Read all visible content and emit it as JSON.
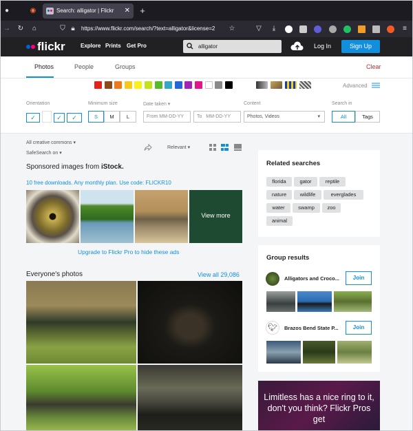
{
  "browser": {
    "tab_title": "Search: alligator | Flickr",
    "url": "https://www.flickr.com/search/?text=alligator&license=2"
  },
  "header": {
    "logo": "flickr",
    "nav": [
      "Explore",
      "Prints",
      "Get Pro"
    ],
    "search_value": "alligator",
    "login": "Log In",
    "signup": "Sign Up"
  },
  "tabs": [
    "Photos",
    "People",
    "Groups"
  ],
  "clear": "Clear",
  "advanced": "Advanced",
  "swatches": [
    "#e2231a",
    "#8a4a19",
    "#ef7a1a",
    "#f8c81b",
    "#f8f11a",
    "#c6e11a",
    "#54bb2b",
    "#34a6c9",
    "#2566d9",
    "#a123b8",
    "#e2158a",
    "#ffffff",
    "#8a8a8a",
    "#000000"
  ],
  "filters": {
    "orientation": "Orientation",
    "min_size": "Minimum size",
    "sizes": [
      "S",
      "M",
      "L"
    ],
    "date_taken": "Date taken",
    "date_from": "From MM-DD-YY",
    "date_to": "To",
    "date_to_ph": "MM-DD-YY",
    "content": "Content",
    "content_value": "Photos, Videos",
    "search_in": "Search in",
    "search_in_opts": [
      "All",
      "Tags"
    ]
  },
  "license": "All creative commons",
  "safesearch": "SafeSearch on",
  "sort": "Relevant",
  "sponsored": {
    "title": "Sponsored images from",
    "brand": "iStock.",
    "promo": "10 free downloads. Any monthly plan. Use code: FLICKR10",
    "view_more": "View more",
    "upgrade": "Upgrade to Flickr Pro to hide these ads"
  },
  "everyone": {
    "title": "Everyone's photos",
    "view_all": "View all 29,086"
  },
  "related": {
    "title": "Related searches",
    "tags": [
      "florida",
      "gator",
      "reptile",
      "nature",
      "wildlife",
      "everglades",
      "water",
      "swamp",
      "zoo",
      "animal"
    ]
  },
  "groups": {
    "title": "Group results",
    "items": [
      {
        "name": "Alligators and Croco...",
        "join": "Join"
      },
      {
        "name": "Brazos Bend State P...",
        "join": "Join"
      }
    ]
  },
  "ad": {
    "text": "Limitless has a nice ring to it, don't you think? Flickr Pros get"
  }
}
